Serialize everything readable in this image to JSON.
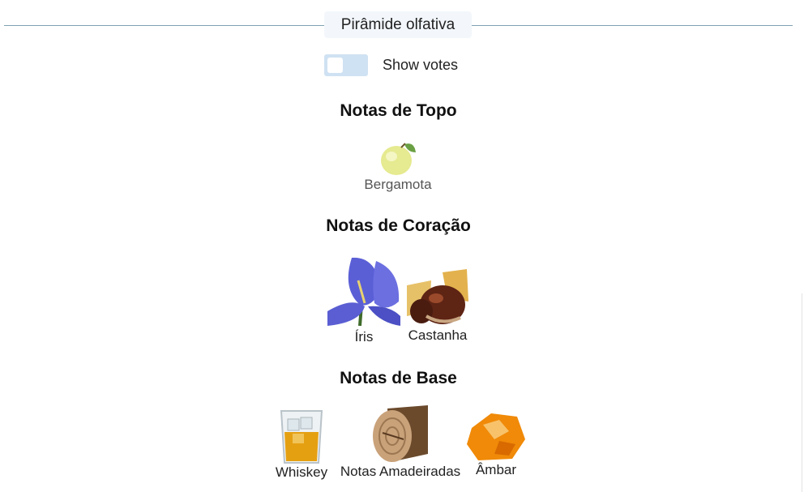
{
  "section": {
    "title": "Pirâmide olfativa"
  },
  "toggle": {
    "label": "Show votes",
    "checked": false
  },
  "groups": {
    "top": {
      "title": "Notas de Topo",
      "notes": [
        {
          "label": "Bergamota",
          "icon": "bergamot-icon"
        }
      ]
    },
    "heart": {
      "title": "Notas de Coração",
      "notes": [
        {
          "label": "Íris",
          "icon": "iris-flower-icon"
        },
        {
          "label": "Castanha",
          "icon": "chestnut-icon"
        }
      ]
    },
    "base": {
      "title": "Notas de Base",
      "notes": [
        {
          "label": "Whiskey",
          "icon": "whiskey-glass-icon"
        },
        {
          "label": "Notas Amadeiradas",
          "icon": "wood-log-icon"
        },
        {
          "label": "Âmbar",
          "icon": "amber-stone-icon"
        }
      ]
    }
  },
  "colors": {
    "divider": "#7fa2b3",
    "toggle_bg": "#cfe2f3",
    "pill_bg": "#f3f7fb"
  }
}
